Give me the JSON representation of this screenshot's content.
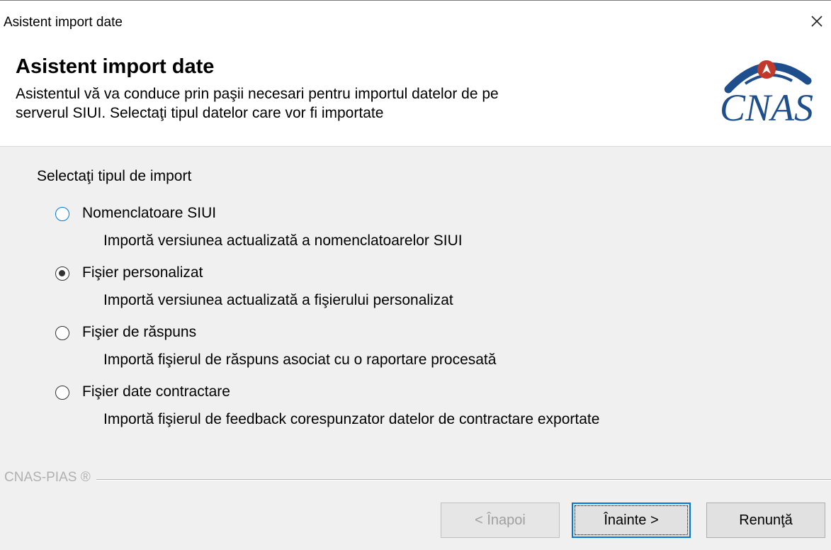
{
  "window": {
    "title": "Asistent import date",
    "close_icon": "close-icon"
  },
  "header": {
    "title": "Asistent import date",
    "description_line1": "Asistentul vă va conduce prin paşii necesari pentru importul datelor de pe",
    "description_line2": "serverul SIUI. Selectaţi tipul datelor care vor fi importate",
    "logo_text": "CNAS",
    "logo_icon": "cnas-logo",
    "logo_color": "#1f4e8c",
    "logo_accent_color": "#c0392b"
  },
  "content": {
    "group_label": "Selectaţi tipul de import",
    "options": [
      {
        "label": "Nomenclatoare SIUI",
        "description": "Importă versiunea actualizată a nomenclatoarelor SIUI",
        "selected": false,
        "focused": true
      },
      {
        "label": "Fişier personalizat",
        "description": "Importă versiunea actualizată a fişierului personalizat",
        "selected": true,
        "focused": false
      },
      {
        "label": "Fişier de răspuns",
        "description": "Importă fişierul de răspuns asociat cu o raportare procesată",
        "selected": false,
        "focused": false
      },
      {
        "label": "Fişier date contractare",
        "description": "Importă fişierul de feedback corespunzator datelor de contractare exportate",
        "selected": false,
        "focused": false
      }
    ],
    "brand": "CNAS-PIAS ®"
  },
  "buttons": {
    "back_label": "< Înapoi",
    "next_label": "Înainte >",
    "cancel_label": "Renunţă"
  },
  "colors": {
    "background": "#f0f0f0",
    "accent": "#0078d7"
  }
}
